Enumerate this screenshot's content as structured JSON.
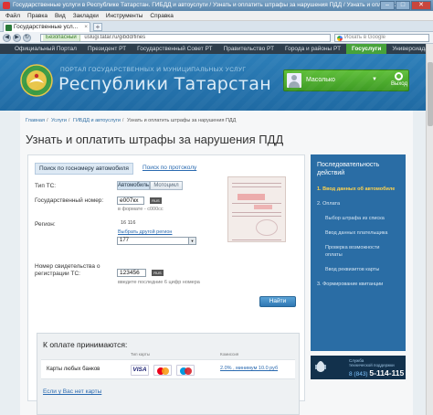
{
  "window": {
    "title": "Государственные услуги в Республике Татарстан. ГИБДД и автоуслуги / Узнать и оплатить штрафы за нарушения ПДД / Узнать и опл... - Opera"
  },
  "menu": [
    "Файл",
    "Правка",
    "Вид",
    "Закладки",
    "Инструменты",
    "Справка"
  ],
  "tab": {
    "label": "Государственные усл..."
  },
  "address": {
    "secure_label": "Безопасный",
    "url": "uslugi.tatar.ru/gibdd/fines",
    "search_placeholder": "Искать в Google"
  },
  "sitenav": [
    "Официальный Портал",
    "Президент РТ",
    "Государственный Совет РТ",
    "Правительство РТ",
    "Города и районы РТ",
    "Госуслуги",
    "Универсиада-2013"
  ],
  "header": {
    "portal_line1": "ПОРТАЛ ГОСУДАРСТВЕННЫХ И МУНИЦИПАЛЬНЫХ УСЛУГ",
    "portal_line2": "Республики Татарстан",
    "user_name": "Масолько",
    "exit_label": "Выход"
  },
  "breadcrumb": [
    "Главная",
    "Услуги",
    "ГИБДД и автоуслуги",
    "Узнать и оплатить штрафы за нарушения ПДД"
  ],
  "page_title": "Узнать и оплатить штрафы за нарушения ПДД",
  "form": {
    "tab_active": "Поиск по госномеру автомобиля",
    "tab_link": "Поиск по протоколу",
    "ts_label": "Тип ТС:",
    "ts_options": [
      "Автомобиль",
      "Мотоцикл"
    ],
    "plate_label": "Государственный номер:",
    "plate_value": "е007кх",
    "plate_flag": "RUS",
    "plate_hint": "в формате - с000сс",
    "region_label": "Регион:",
    "region_codes": "16   116",
    "region_link": "Выбрать другой регион",
    "region_select": "177",
    "cert_label": "Номер свидетельства о регистрации ТС:",
    "cert_value": "123456",
    "cert_flag": "RUS",
    "cert_hint": "введите последние 6 цифр номера",
    "find_button": "Найти"
  },
  "payment": {
    "title": "К оплате принимаются:",
    "col_card_type": "Тип карты",
    "col_fee": "Комиссия",
    "bank_label": "Карты любых банков",
    "visa": "VISA",
    "fee": "2.0% , минимум 10.0 руб",
    "no_card_link": "Если у Вас нет карты"
  },
  "steps": {
    "title": "Последовательность действий",
    "items": [
      {
        "label": "1. Ввод данных об автомобиле",
        "kind": "active"
      },
      {
        "label": "2. Оплата",
        "kind": "main"
      },
      {
        "label": "Выбор штрафа из списка",
        "kind": "sub"
      },
      {
        "label": "Ввод данных плательщика",
        "kind": "sub"
      },
      {
        "label": "Проверка возможности",
        "kind": "sub"
      },
      {
        "label": "оплаты",
        "kind": "sub2"
      },
      {
        "label": "Ввод реквизитов карты",
        "kind": "sub"
      },
      {
        "label": "3. Формирование квитанции",
        "kind": "main"
      }
    ]
  },
  "support": {
    "label_line1": "Служба",
    "label_line2": "технической поддержки",
    "phone_prefix": "8 (843)",
    "phone_number": "5-114-115"
  }
}
